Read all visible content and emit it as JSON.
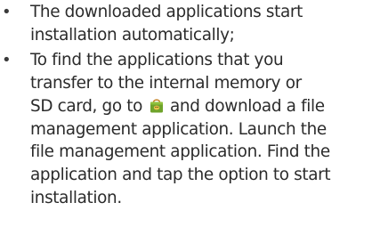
{
  "bullets": [
    {
      "lines": [
        "The downloaded applications start",
        "installation automatically;"
      ]
    },
    {
      "lines_before_icon": [
        "To find the applications that you",
        "transfer to the internal memory or"
      ],
      "icon_line_before": "SD card, go to",
      "icon_line_after": "and download a file",
      "lines_after_icon": [
        "management application. Launch the",
        "file management application. Find the",
        "application and tap the option to start",
        "installation."
      ]
    }
  ],
  "bullet_char": "•",
  "icon": "market-bag-icon",
  "colors": {
    "text": "#2b2b2b",
    "icon_bag": "#6fa32b",
    "icon_handle": "#c8862c"
  }
}
